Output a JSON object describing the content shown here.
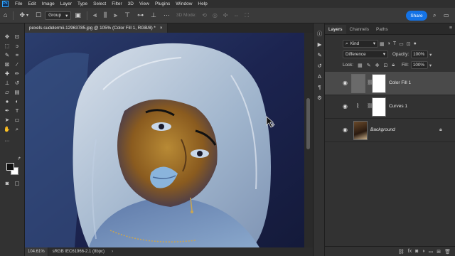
{
  "menubar": {
    "app_icon": "Ps",
    "items": [
      "File",
      "Edit",
      "Image",
      "Layer",
      "Type",
      "Select",
      "Filter",
      "3D",
      "View",
      "Plugins",
      "Window",
      "Help"
    ]
  },
  "options": {
    "home_icon": "home-icon",
    "move_icon": "move-icon",
    "auto_select_label": "Group",
    "mode3d_label": "3D Mode:",
    "share_label": "Share"
  },
  "document": {
    "tab_title": "pexels-sudelermii-12963785.jpg @ 105% (Color Fill 1, RGB/8) *",
    "tab_close": "×",
    "zoom": "104.61%",
    "profile": "sRGB IEC61966-2.1 (8bpc)"
  },
  "panel": {
    "tabs": [
      "Layers",
      "Channels",
      "Paths"
    ],
    "kind_label": "Kind",
    "blend_mode": "Difference",
    "opacity_label": "Opacity:",
    "opacity_value": "100%",
    "lock_label": "Lock:",
    "fill_label": "Fill:",
    "fill_value": "100%",
    "layers": [
      {
        "name": "Color Fill 1",
        "selected": true
      },
      {
        "name": "Curves 1",
        "selected": false
      },
      {
        "name": "Background",
        "selected": false
      }
    ],
    "bottom_icons": [
      "link-icon",
      "fx-icon",
      "mask-icon",
      "adjustment-icon",
      "group-icon",
      "new-layer-icon",
      "trash-icon"
    ]
  },
  "colors": {
    "accent": "#1473e6",
    "canvas_bg": "#1b2244"
  }
}
